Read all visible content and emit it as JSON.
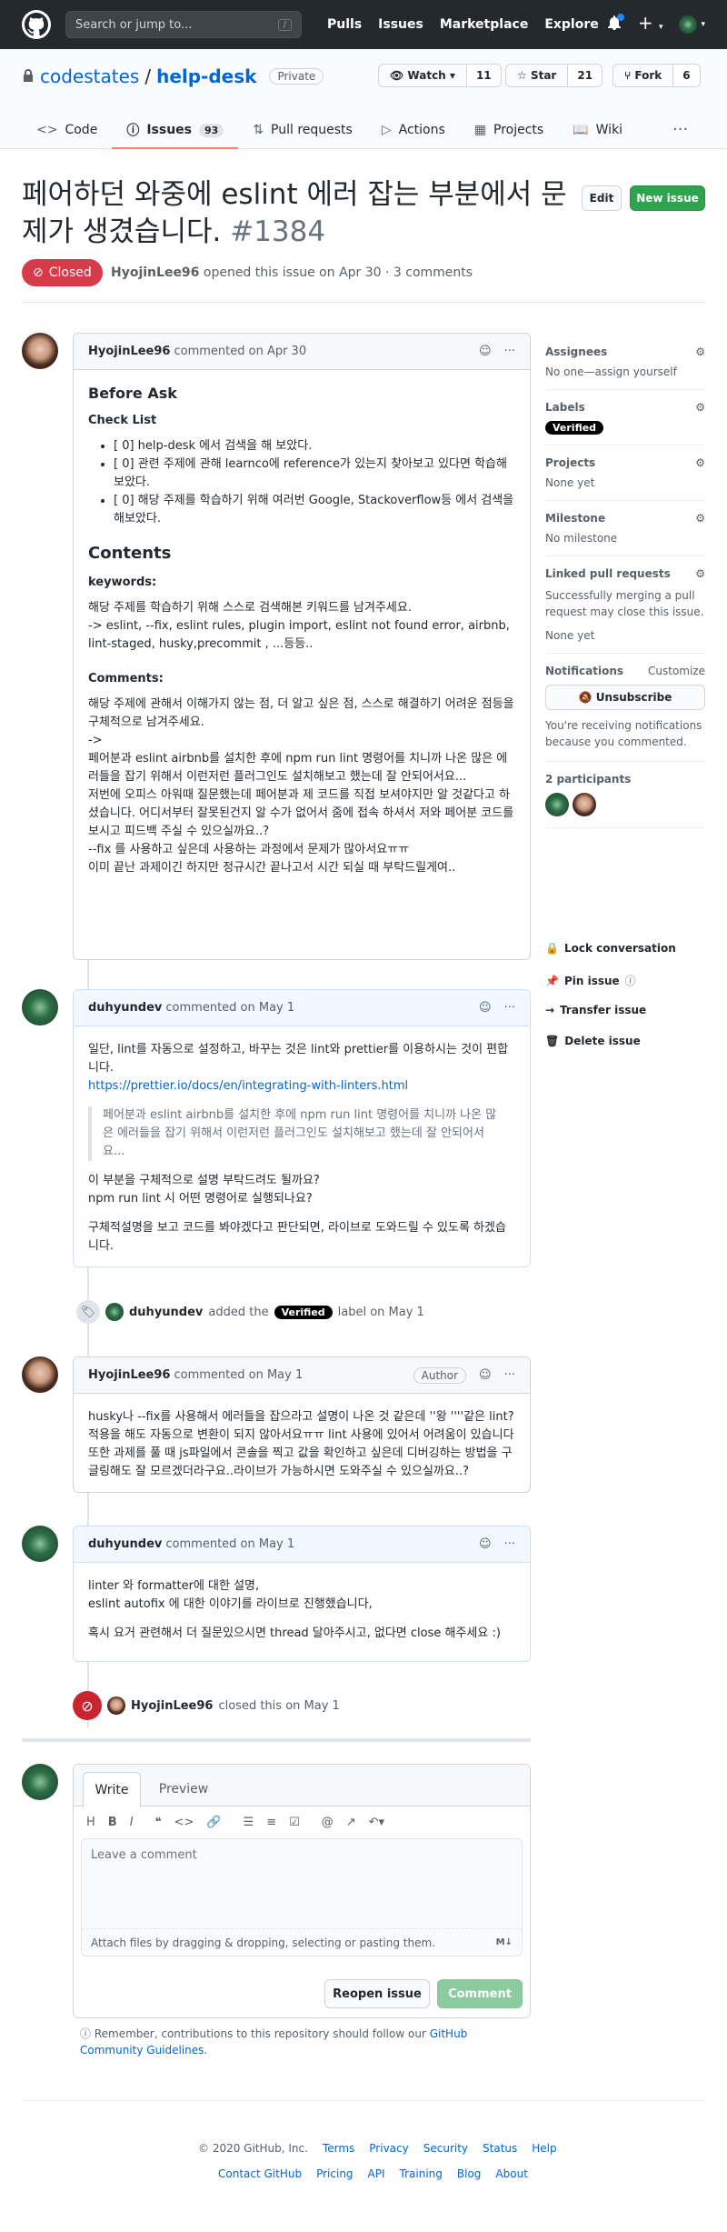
{
  "topnav": {
    "search_placeholder": "Search or jump to...",
    "slash": "/",
    "links": [
      "Pulls",
      "Issues",
      "Marketplace",
      "Explore"
    ]
  },
  "repo": {
    "owner": "codestates",
    "sep": "/",
    "name": "help-desk",
    "visibility": "Private",
    "watch_label": "Watch",
    "watch_count": "11",
    "star_label": "Star",
    "star_count": "21",
    "fork_label": "Fork",
    "fork_count": "6",
    "tabs": [
      {
        "label": "Code"
      },
      {
        "label": "Issues",
        "count": "93"
      },
      {
        "label": "Pull requests"
      },
      {
        "label": "Actions"
      },
      {
        "label": "Projects"
      },
      {
        "label": "Wiki"
      }
    ]
  },
  "issue": {
    "title": "페어하던 와중에 eslint 에러 잡는 부분에서 문제가 생겼습니다.",
    "number": "#1384",
    "edit": "Edit",
    "new_issue": "New issue",
    "state": "Closed",
    "author": "HyojinLee96",
    "meta": "opened this issue on Apr 30 · 3 comments"
  },
  "c1": {
    "author": "HyojinLee96",
    "when": "commented on Apr 30",
    "h_before": "Before Ask",
    "h_check": "Check List",
    "checks": [
      "[ 0] help-desk 에서 검색을 해 보았다.",
      "[ 0] 관련 주제에 관해 learnco에 reference가 있는지 찾아보고 있다면 학습해보았다.",
      "[ 0] 해당 주제를 학습하기 위해 여러번 Google, Stackoverflow등 에서 검색을 해보았다."
    ],
    "h_contents": "Contents",
    "h_keywords": "keywords:",
    "kw1": "해당 주제를 학습하기 위해 스스로 검색해본 키워드를 남겨주세요.",
    "kw2": "-> eslint, --fix, eslint rules, plugin import, eslint not found error, airbnb, lint-staged, husky,precommit , ...등등..",
    "h_comments": "Comments:",
    "cm1": "해당 주제에 관해서 이해가지 않는 점, 더 알고 싶은 점, 스스로 해결하기 어려운 점등을 구체적으로 남겨주세요.",
    "cm2": "->",
    "cm3": "페어분과 eslint airbnb를 설치한 후에 npm run lint 명령어를 치니까 나온 많은 에러들을 잡기 위해서 이런저런 플러그인도 설치해보고 했는데 잘 안되어서요...",
    "cm4": "저번에 오피스 아워때 질문했는데 페어분과 제 코드를 직접 보셔야지만 알 것같다고 하셨습니다. 어디서부터 잘못된건지 알 수가 없어서 줌에 접속 하셔서 저와 페어분 코드를 보시고 피드백 주실 수 있으실까요..?",
    "cm5": "--fix 를 사용하고 싶은데 사용하는 과정에서 문제가 많아서요ㅠㅠ",
    "cm6": "이미 끝난 과제이긴 하지만 정규시간 끝나고서 시간 되실 때 부탁드릴게여.."
  },
  "c2": {
    "author": "duhyundev",
    "when": "commented on May 1",
    "p1": "일단, lint를 자동으로 설정하고, 바꾸는 것은 lint와 prettier를 이용하시는 것이 편합니다.",
    "link": "https://prettier.io/docs/en/integrating-with-linters.html",
    "quote": "페어분과 eslint airbnb를 설치한 후에 npm run lint 명령어를 치니까 나온 많은 에러들을 잡기 위해서 이런저런 플러그인도 설치해보고 했는데 잘 안되어서요...",
    "p2": "이 부분을 구체적으로 설명 부탁드려도 될까요?",
    "p3": "npm run lint 시 어떤 명령어로 실행되나요?",
    "p4": "구체적설명을 보고 코드를 봐야겠다고 판단되면, 라이브로 도와드릴 수 있도록 하겠습니다."
  },
  "e1": {
    "author": "duhyundev",
    "pre": "added the",
    "label": "Verified",
    "post": "label on May 1"
  },
  "c3": {
    "author": "HyojinLee96",
    "when": "commented on May 1",
    "badge": "Author",
    "p1": "husky나 --fix를 사용해서 에러들을 잡으라고 설명이 나온 것 같은데 ''왕 ''''같은 lint?적용을 해도 자동으로 변환이 되지 않아서요ㅠㅠ lint 사용에 있어서 어려움이 있습니다 또한 과제를 풀 때 js파일에서 콘솔을 찍고 값을 확인하고 싶은데 디버깅하는 방법을 구글링해도 잘 모르겠더라구요..라이브가 가능하시면 도와주실 수 있으실까요..?"
  },
  "c4": {
    "author": "duhyundev",
    "when": "commented on May 1",
    "p1": "linter 와 formatter에 대한 설명,",
    "p2": "eslint autofix 에 대한 이야기를 라이브로 진행했습니다,",
    "p3": "혹시 요거 관련해서 더 질문있으시면 thread 달아주시고, 없다면 close 해주세요 :)"
  },
  "e2": {
    "author": "HyojinLee96",
    "post": "closed this on May 1"
  },
  "editor": {
    "tab_write": "Write",
    "tab_preview": "Preview",
    "placeholder": "Leave a comment",
    "attach": "Attach files by dragging & dropping, selecting or pasting them.",
    "md": "M↓",
    "reopen": "Reopen issue",
    "comment": "Comment",
    "note_pre": "Remember, contributions to this repository should follow our",
    "note_link": "GitHub Community Guidelines",
    "note_post": "."
  },
  "sidebar": {
    "assignees_h": "Assignees",
    "assignees_v": "No one—assign yourself",
    "labels_h": "Labels",
    "label": "Verified",
    "projects_h": "Projects",
    "projects_v": "None yet",
    "milestone_h": "Milestone",
    "milestone_v": "No milestone",
    "linked_h": "Linked pull requests",
    "linked_desc": "Successfully merging a pull request may close this issue.",
    "linked_v": "None yet",
    "notif_h": "Notifications",
    "customize": "Customize",
    "unsubscribe": "Unsubscribe",
    "notif_desc": "You're receiving notifications because you commented.",
    "participants": "2 participants",
    "lock": "Lock conversation",
    "pin": "Pin issue",
    "transfer": "Transfer issue",
    "delete": "Delete issue"
  },
  "footer": {
    "copy": "© 2020 GitHub, Inc.",
    "row1": [
      "Terms",
      "Privacy",
      "Security",
      "Status",
      "Help"
    ],
    "row2": [
      "Contact GitHub",
      "Pricing",
      "API",
      "Training",
      "Blog",
      "About"
    ]
  }
}
